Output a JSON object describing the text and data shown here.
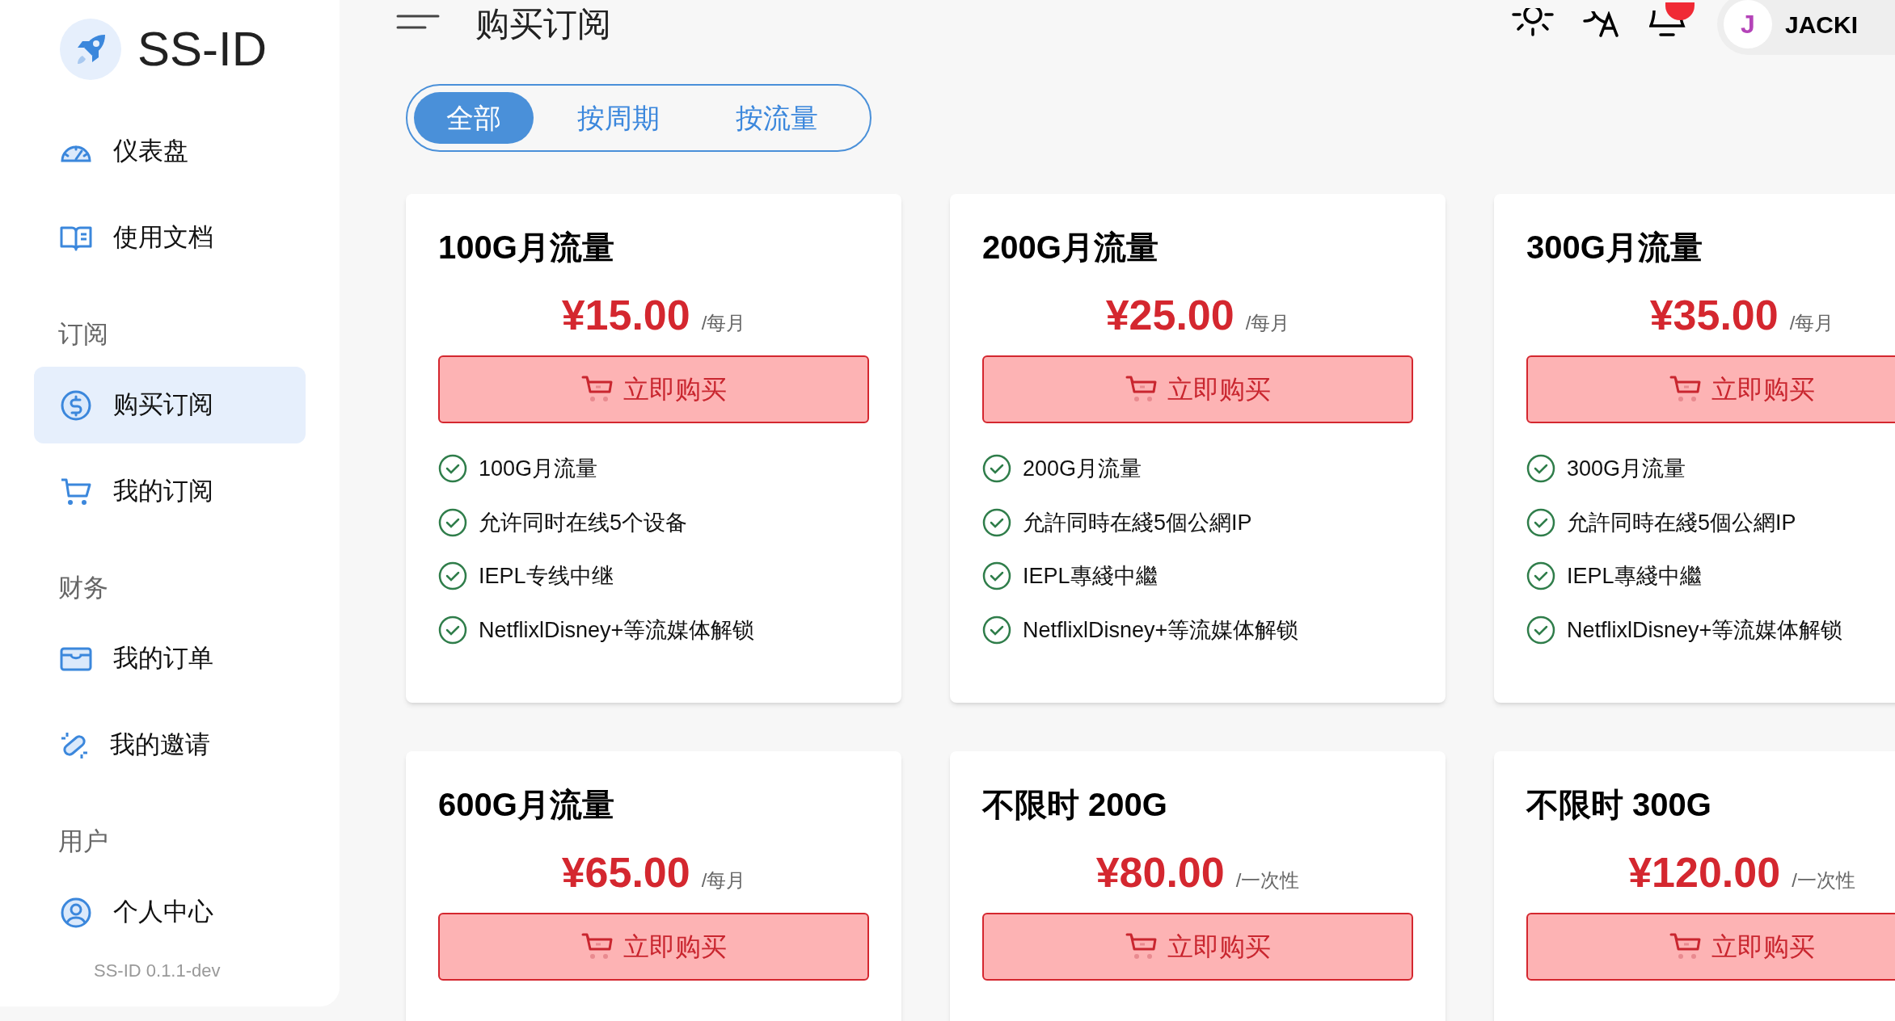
{
  "sidebar": {
    "brand": "SS-ID",
    "version": "SS-ID 0.1.1-dev",
    "items": [
      {
        "kind": "item",
        "label": "仪表盘",
        "selected": false
      },
      {
        "kind": "item",
        "label": "使用文档",
        "selected": false
      },
      {
        "kind": "section",
        "label": "订阅"
      },
      {
        "kind": "item",
        "label": "购买订阅",
        "selected": true
      },
      {
        "kind": "item",
        "label": "我的订阅",
        "selected": false
      },
      {
        "kind": "section",
        "label": "财务"
      },
      {
        "kind": "item",
        "label": "我的订单",
        "selected": false
      },
      {
        "kind": "item",
        "label": "我的邀请",
        "selected": false
      },
      {
        "kind": "section",
        "label": "用户"
      },
      {
        "kind": "item",
        "label": "个人中心",
        "selected": false
      }
    ]
  },
  "header": {
    "title": "购买订阅",
    "avatar_letter": "J",
    "username": "JACKI",
    "notification_dot": true
  },
  "tabs": [
    {
      "label": "全部",
      "selected": true
    },
    {
      "label": "按周期",
      "selected": false
    },
    {
      "label": "按流量",
      "selected": false
    }
  ],
  "plans": [
    {
      "name": "100G月流量",
      "price": "¥15.00",
      "period": "/每月",
      "button": "立即购买",
      "features": [
        "100G月流量",
        "允许同时在线5个设备",
        "IEPL专线中继",
        "NetflixlDisney+等流媒体解锁"
      ]
    },
    {
      "name": "200G月流量",
      "price": "¥25.00",
      "period": "/每月",
      "button": "立即购买",
      "features": [
        "200G月流量",
        "允許同時在綫5個公網IP",
        "IEPL專綫中繼",
        "NetflixlDisney+等流媒体解锁"
      ]
    },
    {
      "name": "300G月流量",
      "price": "¥35.00",
      "period": "/每月",
      "button": "立即购买",
      "features": [
        "300G月流量",
        "允許同時在綫5個公網IP",
        "IEPL專綫中繼",
        "NetflixlDisney+等流媒体解锁"
      ]
    },
    {
      "name": "600G月流量",
      "price": "¥65.00",
      "period": "/每月",
      "button": "立即购买"
    },
    {
      "name": "不限时 200G",
      "price": "¥80.00",
      "period": "/一次性",
      "button": "立即购买"
    },
    {
      "name": "不限时 300G",
      "price": "¥120.00",
      "period": "/一次性",
      "button": "立即购买"
    }
  ]
}
